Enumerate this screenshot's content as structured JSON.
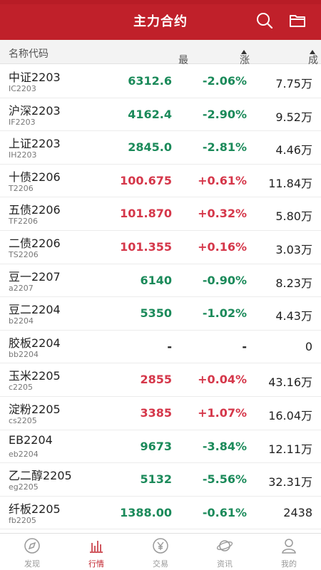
{
  "header": {
    "title": "主力合约",
    "bg_color": "#c0202a",
    "icons": [
      "search-icon",
      "folder-icon"
    ]
  },
  "columns": {
    "name": "名称代码",
    "price": "最新价",
    "change": "涨跌幅",
    "volume": "成交量"
  },
  "colors": {
    "up": "#d5374a",
    "down": "#1b8a5a",
    "flat": "#222222"
  },
  "rows": [
    {
      "name": "中证2203",
      "code": "IC2203",
      "price": "6312.6",
      "change": "-2.06%",
      "volume": "7.75万",
      "trend": "down"
    },
    {
      "name": "沪深2203",
      "code": "IF2203",
      "price": "4162.4",
      "change": "-2.90%",
      "volume": "9.52万",
      "trend": "down"
    },
    {
      "name": "上证2203",
      "code": "IH2203",
      "price": "2845.0",
      "change": "-2.81%",
      "volume": "4.46万",
      "trend": "down"
    },
    {
      "name": "十债2206",
      "code": "T2206",
      "price": "100.675",
      "change": "+0.61%",
      "volume": "11.84万",
      "trend": "up"
    },
    {
      "name": "五债2206",
      "code": "TF2206",
      "price": "101.870",
      "change": "+0.32%",
      "volume": "5.80万",
      "trend": "up"
    },
    {
      "name": "二债2206",
      "code": "TS2206",
      "price": "101.355",
      "change": "+0.16%",
      "volume": "3.03万",
      "trend": "up"
    },
    {
      "name": "豆一2207",
      "code": "a2207",
      "price": "6140",
      "change": "-0.90%",
      "volume": "8.23万",
      "trend": "down"
    },
    {
      "name": "豆二2204",
      "code": "b2204",
      "price": "5350",
      "change": "-1.02%",
      "volume": "4.43万",
      "trend": "down"
    },
    {
      "name": "胶板2204",
      "code": "bb2204",
      "price": "-",
      "change": "-",
      "volume": "0",
      "trend": "flat"
    },
    {
      "name": "玉米2205",
      "code": "c2205",
      "price": "2855",
      "change": "+0.04%",
      "volume": "43.16万",
      "trend": "up"
    },
    {
      "name": "淀粉2205",
      "code": "cs2205",
      "price": "3385",
      "change": "+1.07%",
      "volume": "16.04万",
      "trend": "up"
    },
    {
      "name": "EB2204",
      "code": "eb2204",
      "price": "9673",
      "change": "-3.84%",
      "volume": "12.11万",
      "trend": "down"
    },
    {
      "name": "乙二醇2205",
      "code": "eg2205",
      "price": "5132",
      "change": "-5.56%",
      "volume": "32.31万",
      "trend": "down"
    },
    {
      "name": "纤板2205",
      "code": "fb2205",
      "price": "1388.00",
      "change": "-0.61%",
      "volume": "2438",
      "trend": "down"
    }
  ],
  "tabs": [
    {
      "label": "发现",
      "icon": "discover-icon",
      "active": false
    },
    {
      "label": "行情",
      "icon": "market-chart-icon",
      "active": true
    },
    {
      "label": "交易",
      "icon": "trade-yen-icon",
      "active": false
    },
    {
      "label": "资讯",
      "icon": "news-planet-icon",
      "active": false
    },
    {
      "label": "我的",
      "icon": "profile-icon",
      "active": false
    }
  ]
}
